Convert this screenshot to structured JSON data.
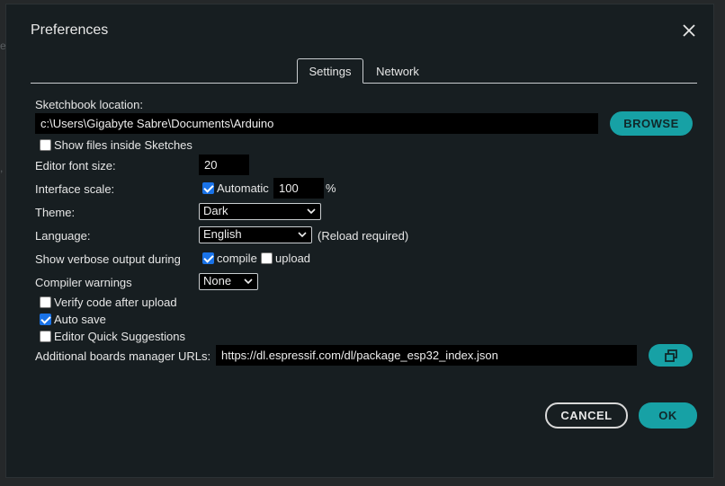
{
  "dialog": {
    "title": "Preferences"
  },
  "tabs": [
    {
      "label": "Settings",
      "active": true
    },
    {
      "label": "Network",
      "active": false
    }
  ],
  "sketchbook": {
    "label": "Sketchbook location:",
    "value": "c:\\Users\\Gigabyte Sabre\\Documents\\Arduino",
    "browse_label": "BROWSE"
  },
  "show_files": {
    "label": "Show files inside Sketches",
    "checked": false
  },
  "font_size": {
    "label": "Editor font size:",
    "value": "20"
  },
  "interface_scale": {
    "label": "Interface scale:",
    "automatic_label": "Automatic",
    "automatic_checked": true,
    "value": "100",
    "unit": "%"
  },
  "theme": {
    "label": "Theme:",
    "selected": "Dark"
  },
  "language": {
    "label": "Language:",
    "selected": "English",
    "note": "(Reload required)"
  },
  "verbose": {
    "label": "Show verbose output during",
    "compile_label": "compile",
    "compile_checked": true,
    "upload_label": "upload",
    "upload_checked": false
  },
  "compiler_warnings": {
    "label": "Compiler warnings",
    "selected": "None"
  },
  "verify": {
    "label": "Verify code after upload",
    "checked": false
  },
  "auto_save": {
    "label": "Auto save",
    "checked": true
  },
  "quick_suggestions": {
    "label": "Editor Quick Suggestions",
    "checked": false
  },
  "boards_urls": {
    "label": "Additional boards manager URLs:",
    "value": "https://dl.espressif.com/dl/package_esp32_index.json"
  },
  "footer": {
    "cancel_label": "CANCEL",
    "ok_label": "OK"
  },
  "colors": {
    "accent": "#17a1a5",
    "background": "#171e21",
    "checkbox_checked": "#1a73e8"
  },
  "icons": {
    "close": "close-icon",
    "expand": "open-in-window-icon",
    "chevron": "chevron-down-icon"
  }
}
